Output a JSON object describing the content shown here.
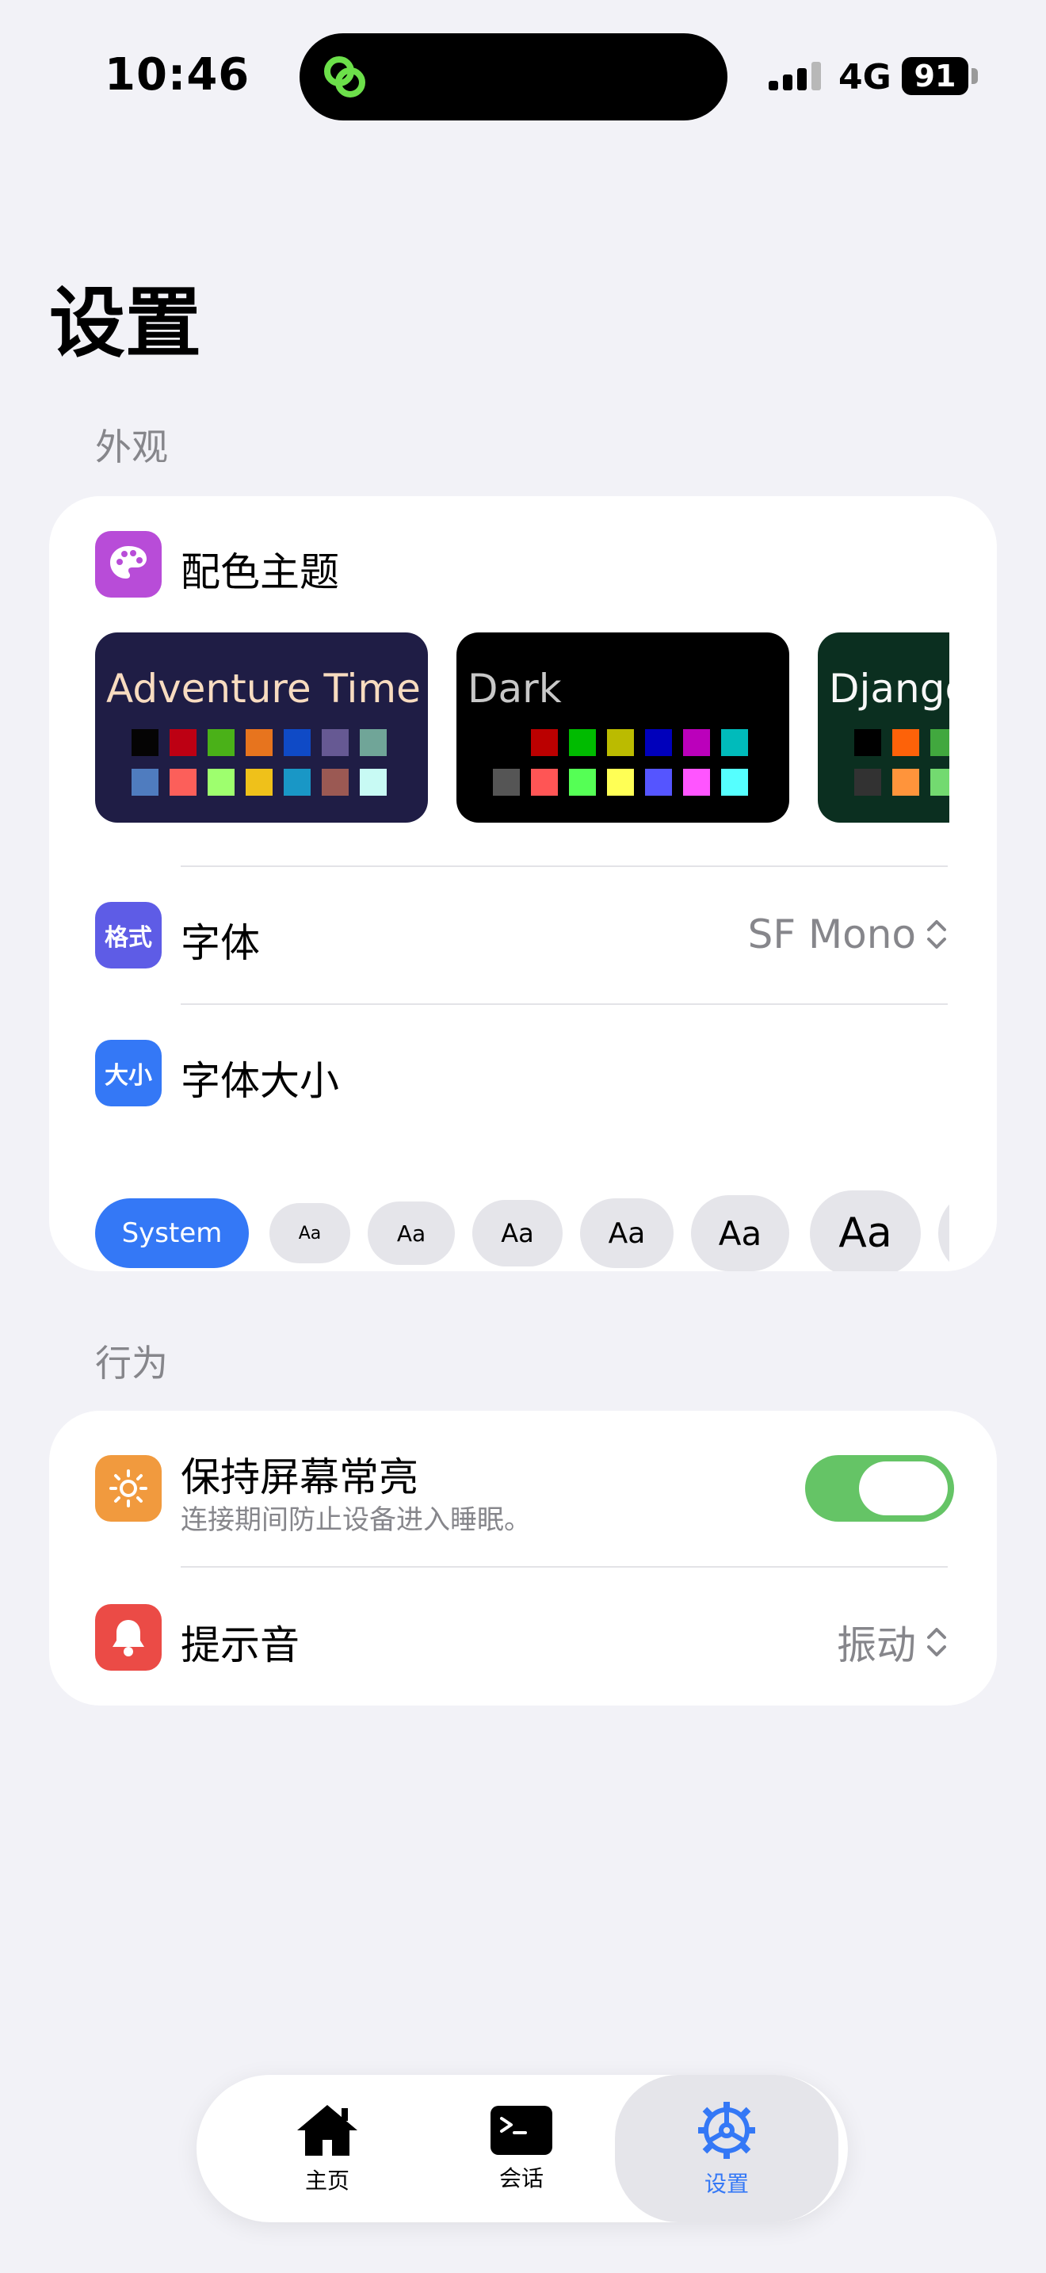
{
  "status_bar": {
    "time": "10:46",
    "network": "4G",
    "battery": "91"
  },
  "page": {
    "title": "设置"
  },
  "appearance": {
    "header": "外观",
    "color_theme": {
      "label": "配色主题",
      "icon": "palette-icon",
      "themes": [
        {
          "name": "Adventure Time",
          "bg": "#1F1D45",
          "text": "#F8DCC0",
          "row1": [
            "#050404",
            "#BD0013",
            "#4AB118",
            "#E7741E",
            "#0F4AC6",
            "#665993",
            "#70A598"
          ],
          "row2": [
            "#4F7CBF",
            "#FC5F5A",
            "#9EFF6E",
            "#EFC11A",
            "#1997C6",
            "#9B5953",
            "#C8FAF4"
          ]
        },
        {
          "name": "Dark",
          "bg": "#000000",
          "text": "#C8C8C8",
          "row1": [
            "#000000",
            "#BB0000",
            "#00BB00",
            "#BBBB00",
            "#0000BB",
            "#BB00BB",
            "#00BBBB"
          ],
          "row2": [
            "#555555",
            "#FF5555",
            "#55FF55",
            "#FFFF55",
            "#5555FF",
            "#FF55FF",
            "#55FFFF"
          ]
        },
        {
          "name": "Django",
          "bg": "#0B2F20",
          "text": "#F8F8F8",
          "row1": [
            "#000000",
            "#FD6209",
            "#41A83E",
            "#FFE862",
            "#245032",
            "#F8F8F8",
            "#9DF39F"
          ],
          "row2": [
            "#323232",
            "#FF943B",
            "#73DA70",
            "#FFFF94",
            "#568264",
            "#FFFFFF",
            "#CFFFD1"
          ]
        }
      ]
    },
    "font": {
      "label": "字体",
      "icon_text": "格式",
      "value": "SF Mono"
    },
    "font_size": {
      "label": "字体大小",
      "icon_text": "大小",
      "options": [
        "System",
        "Aa",
        "Aa",
        "Aa",
        "Aa",
        "Aa",
        "Aa",
        "Aa"
      ],
      "selected": 0
    }
  },
  "behavior": {
    "header": "行为",
    "keep_awake": {
      "label": "保持屏幕常亮",
      "subtitle": "连接期间防止设备进入睡眠。",
      "enabled": true,
      "icon": "sun-icon"
    },
    "alert_sound": {
      "label": "提示音",
      "value": "振动",
      "icon": "bell-icon"
    }
  },
  "tabbar": {
    "items": [
      {
        "label": "主页",
        "icon": "home-icon"
      },
      {
        "label": "会话",
        "icon": "terminal-icon"
      },
      {
        "label": "设置",
        "icon": "gear-icon"
      }
    ],
    "active_index": 2
  },
  "colors": {
    "accent": "#3478F6",
    "toggle_on": "#65C466",
    "theme_icon": "#B84CD8",
    "font_icon": "#5E5CE6",
    "size_icon": "#3478F6",
    "sun_icon": "#F19A3E",
    "bell_icon": "#EB4B46"
  }
}
